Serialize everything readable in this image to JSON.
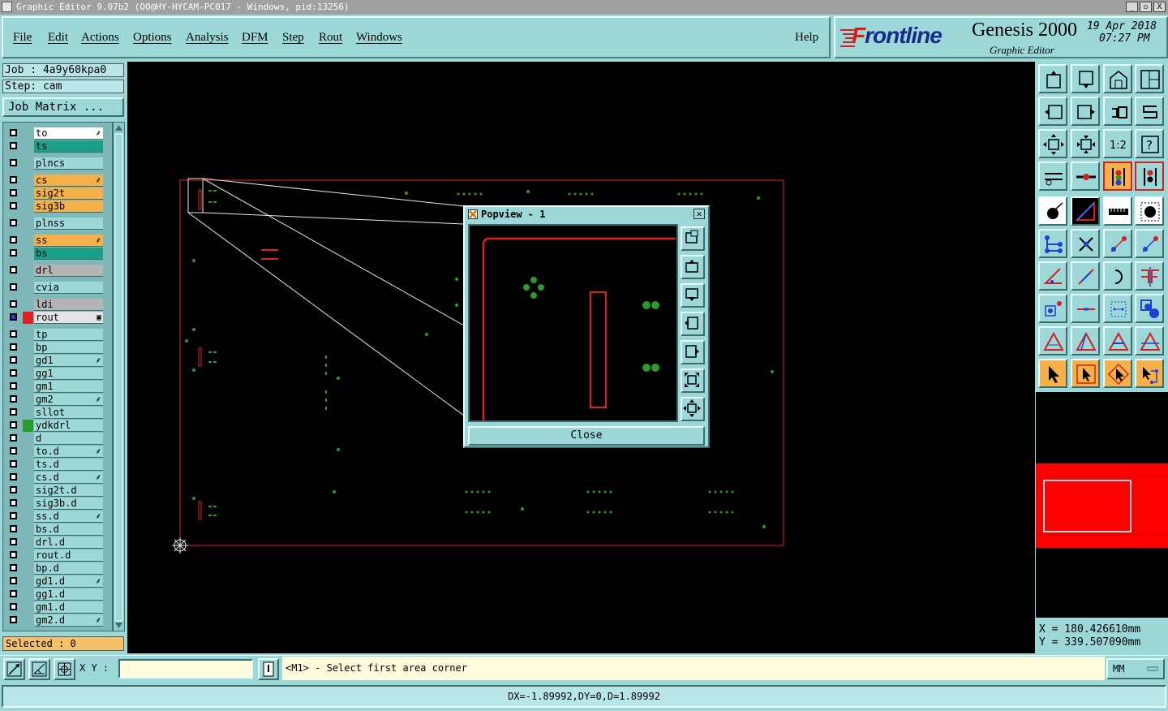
{
  "window": {
    "title": "Graphic Editor 9.07b2 (OO@HY-HYCAM-PC017 - Windows, pid:13256)",
    "controls": [
      "_",
      "▫",
      "X"
    ]
  },
  "menu": [
    "File",
    "Edit",
    "Actions",
    "Options",
    "Analysis",
    "DFM",
    "Step",
    "Rout",
    "Windows"
  ],
  "help": "Help",
  "brand": {
    "logo": "Frontline",
    "product": "Genesis 2000",
    "subtitle": "Graphic Editor",
    "date": "19 Apr 2018",
    "time": "07:27 PM"
  },
  "job": {
    "job_label": "Job : 4a9y60kpa0",
    "step_label": "Step: cam",
    "matrix_button": "Job Matrix ..."
  },
  "layers": [
    {
      "name": "to",
      "color": "#ffffff",
      "flag": "⸙"
    },
    {
      "name": "ts",
      "color": "#1aa088",
      "flag": ""
    },
    {
      "name": "plncs",
      "color": "#9dd8d8",
      "flag": ""
    },
    {
      "name": "cs",
      "color": "#f6b04a",
      "flag": "⸙"
    },
    {
      "name": "sig2t",
      "color": "#f6b04a",
      "flag": ""
    },
    {
      "name": "sig3b",
      "color": "#f6b04a",
      "flag": ""
    },
    {
      "name": "plnss",
      "color": "#9dd8d8",
      "flag": ""
    },
    {
      "name": "ss",
      "color": "#f6b04a",
      "flag": "⸙"
    },
    {
      "name": "bs",
      "color": "#1aa088",
      "flag": ""
    },
    {
      "name": "drl",
      "color": "#b4b4b4",
      "flag": ""
    },
    {
      "name": "cvia",
      "color": "#9dd8d8",
      "flag": ""
    },
    {
      "name": "ldi",
      "color": "#b4b4b4",
      "flag": ""
    },
    {
      "name": "rout",
      "color": "#e4e4e4",
      "flag": "▣"
    },
    {
      "name": "tp",
      "color": "#9dd8d8",
      "flag": ""
    },
    {
      "name": "bp",
      "color": "#9dd8d8",
      "flag": ""
    },
    {
      "name": "gd1",
      "color": "#9dd8d8",
      "flag": "⸙"
    },
    {
      "name": "gg1",
      "color": "#9dd8d8",
      "flag": ""
    },
    {
      "name": "gm1",
      "color": "#9dd8d8",
      "flag": ""
    },
    {
      "name": "gm2",
      "color": "#9dd8d8",
      "flag": "⸙"
    },
    {
      "name": "sllot",
      "color": "#9dd8d8",
      "flag": ""
    },
    {
      "name": "ydkdrl",
      "color": "#9dd8d8",
      "flag": ""
    },
    {
      "name": "d",
      "color": "#9dd8d8",
      "flag": ""
    },
    {
      "name": "to.d",
      "color": "#9dd8d8",
      "flag": "⸙"
    },
    {
      "name": "ts.d",
      "color": "#9dd8d8",
      "flag": ""
    },
    {
      "name": "cs.d",
      "color": "#9dd8d8",
      "flag": "⸙"
    },
    {
      "name": "sig2t.d",
      "color": "#9dd8d8",
      "flag": ""
    },
    {
      "name": "sig3b.d",
      "color": "#9dd8d8",
      "flag": ""
    },
    {
      "name": "ss.d",
      "color": "#9dd8d8",
      "flag": "⸙"
    },
    {
      "name": "bs.d",
      "color": "#9dd8d8",
      "flag": ""
    },
    {
      "name": "drl.d",
      "color": "#9dd8d8",
      "flag": ""
    },
    {
      "name": "rout.d",
      "color": "#9dd8d8",
      "flag": ""
    },
    {
      "name": "bp.d",
      "color": "#9dd8d8",
      "flag": ""
    },
    {
      "name": "gd1.d",
      "color": "#9dd8d8",
      "flag": "⸙"
    },
    {
      "name": "gg1.d",
      "color": "#9dd8d8",
      "flag": ""
    },
    {
      "name": "gm1.d",
      "color": "#9dd8d8",
      "flag": ""
    },
    {
      "name": "gm2.d",
      "color": "#9dd8d8",
      "flag": "⸙"
    }
  ],
  "selected": "Selected : 0",
  "popview": {
    "title": "Popview - 1",
    "close_label": "Close"
  },
  "coords": {
    "x": "X  =  180.426610mm",
    "y": "Y  =  339.507090mm"
  },
  "bottom": {
    "xy_label": "X Y :",
    "xy_value": "",
    "prompt": "<M1> - Select first area corner",
    "units": "MM"
  },
  "status": "DX=-1.89992,DY=0,D=1.89992",
  "colors": {
    "background": "#9dd8d8",
    "canvas": "#000000",
    "profile": "#e02020",
    "features": "#2a9a2a",
    "accent_orange": "#f6b04a"
  }
}
